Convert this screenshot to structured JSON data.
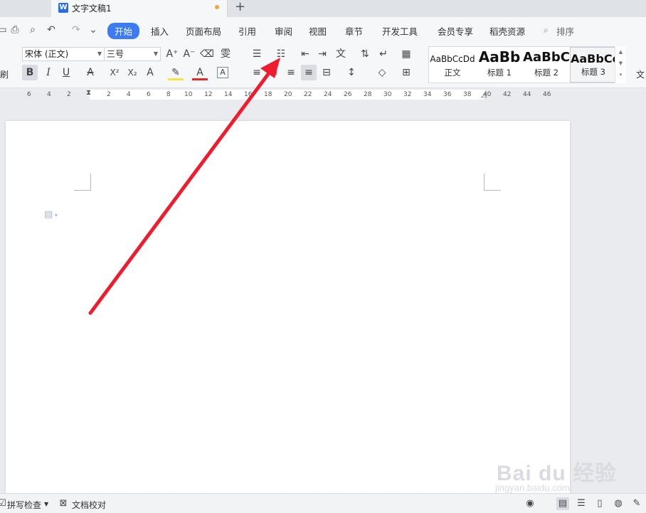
{
  "window": {
    "doc_tab_title": "文字文稿1",
    "add_tab_glyph": "+"
  },
  "quick_access": {
    "save_glyph": "▭",
    "print_glyph": "⎙",
    "preview_glyph": "⌕",
    "undo_glyph": "↶",
    "redo_glyph": "↷",
    "more_glyph": "⌄"
  },
  "menu": {
    "items": [
      "开始",
      "插入",
      "页面布局",
      "引用",
      "审阅",
      "视图",
      "章节",
      "开发工具",
      "会员专享",
      "稻壳资源"
    ],
    "search_label": "排序"
  },
  "ribbon": {
    "brush_label": "刷",
    "font_name": "宋体 (正文)",
    "font_size": "三号",
    "grow_font": "A⁺",
    "shrink_font": "A⁻",
    "clear_format": "⌫",
    "phonetic": "雯",
    "bold": "B",
    "italic": "I",
    "underline": "U",
    "strike": "A",
    "superscript": "X²",
    "subscript": "X₂",
    "text_effect": "A",
    "highlight": "✎",
    "font_color": "A",
    "char_border": "A",
    "bullets": "☰",
    "numbering": "☷",
    "outdent": "⇤",
    "indent": "⇥",
    "chinese_layout": "文",
    "sort": "⇅",
    "show_marks": "↵",
    "table_glyph": "▦",
    "align_left": "≡",
    "align_center": "≡",
    "align_right": "≡",
    "justify": "≡",
    "distribute": "⊟",
    "line_spacing": "↕",
    "shading": "◇",
    "borders": "⊞",
    "styles_more_label": "文",
    "styles": [
      {
        "sample": "AaBbCcDd",
        "name": "正文"
      },
      {
        "sample": "AaBb",
        "name": "标题 1"
      },
      {
        "sample": "AaBbC",
        "name": "标题 2"
      },
      {
        "sample": "AaBbCc",
        "name": "标题 3"
      }
    ]
  },
  "ruler": {
    "left_numbers": [
      "6",
      "4",
      "2"
    ],
    "right_numbers": [
      "2",
      "4",
      "6",
      "8",
      "10",
      "12",
      "14",
      "16",
      "18",
      "20",
      "22",
      "24",
      "26",
      "28",
      "30",
      "32",
      "34",
      "36",
      "38",
      "40",
      "42",
      "44",
      "46"
    ]
  },
  "document": {
    "para_mark_glyph": "▤"
  },
  "watermark": {
    "brand": "Bai du 经验",
    "sub": "jingyan.baidu.com"
  },
  "status": {
    "spell_check": "拼写检查",
    "doc_proof": "文档校对",
    "eye_glyph": "◉",
    "page_view_glyph": "▤",
    "outline_glyph": "☰",
    "read_glyph": "▯",
    "web_glyph": "◍",
    "pen_glyph": "✎"
  },
  "colors": {
    "accent": "#3c7bf4",
    "arrow": "#ee1c2e",
    "word_icon": "#2b6de5",
    "unsaved_dot": "#f2a53a"
  }
}
